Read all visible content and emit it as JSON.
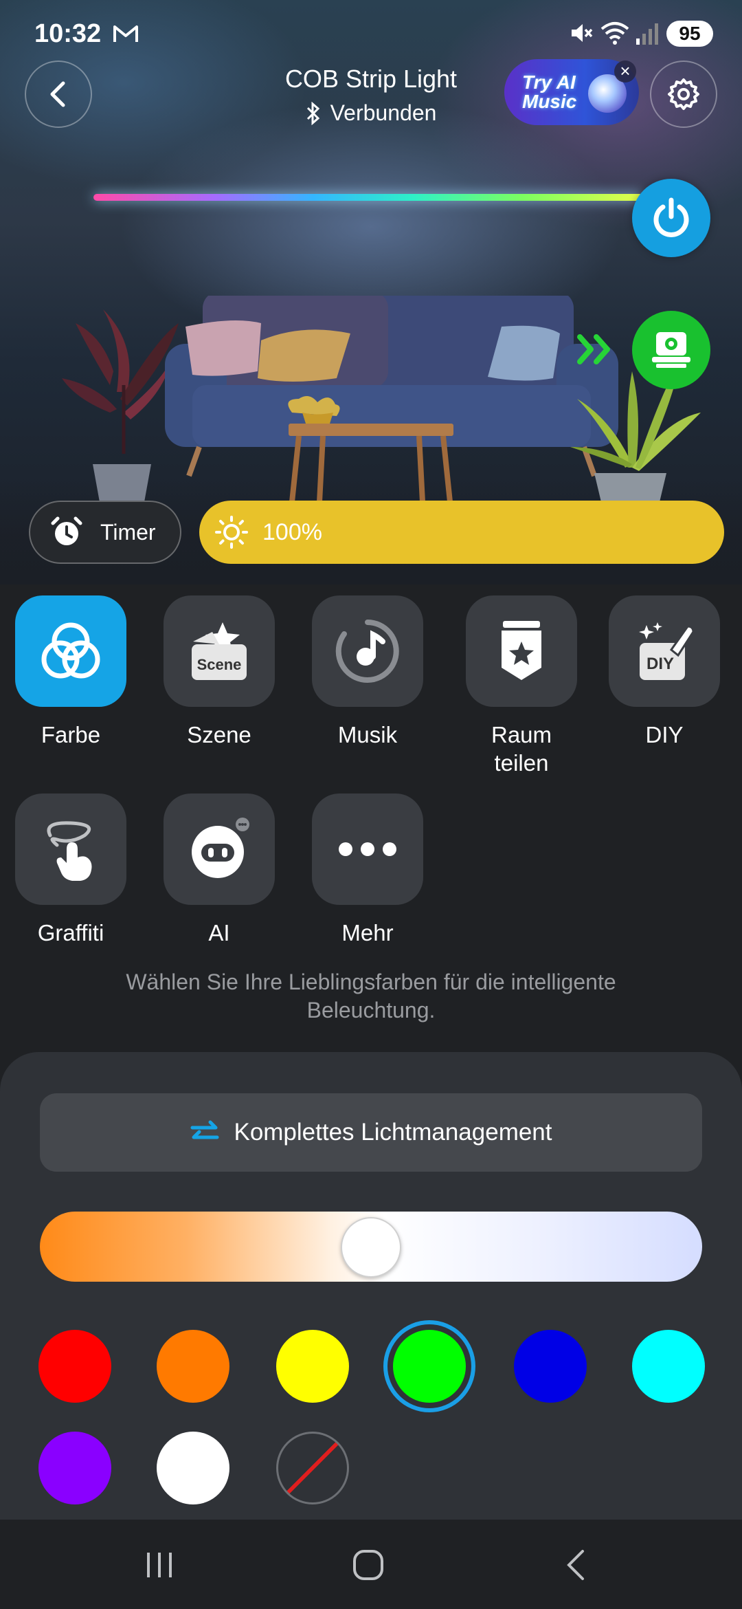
{
  "status_bar": {
    "time": "10:32",
    "battery": "95"
  },
  "header": {
    "title": "COB Strip Light",
    "connection_status": "Verbunden",
    "ai_banner_text": "Try AI Music"
  },
  "controls": {
    "timer_label": "Timer",
    "brightness_value": "100%",
    "brightness_level": 1.0
  },
  "modes": [
    {
      "label": "Farbe",
      "icon": "color-circles-icon",
      "active": true
    },
    {
      "label": "Szene",
      "icon": "scene-icon",
      "active": false,
      "badge": "Scene"
    },
    {
      "label": "Musik",
      "icon": "music-icon",
      "active": false
    },
    {
      "label": "Raum\nteilen",
      "icon": "share-room-icon",
      "active": false
    },
    {
      "label": "DIY",
      "icon": "diy-icon",
      "active": false,
      "badge": "DIY"
    },
    {
      "label": "Graffiti",
      "icon": "graffiti-icon",
      "active": false
    },
    {
      "label": "AI",
      "icon": "ai-robot-icon",
      "active": false
    },
    {
      "label": "Mehr",
      "icon": "more-icon",
      "active": false
    }
  ],
  "hint_text": "Wählen Sie Ihre Lieblingsfarben für die intelligente Beleuchtung.",
  "sheet": {
    "manage_label": "Komplettes Lichtmanagement",
    "color_temperature_position": 0.5,
    "swatches": [
      "#ff0000",
      "#ff7a00",
      "#ffff00",
      "#00ff00",
      "#0000e6",
      "#00ffff",
      "#8a00ff",
      "#ffffff",
      "none"
    ],
    "selected_swatch": 3
  },
  "colors": {
    "accent": "#15a4e6",
    "power": "#159fe0",
    "device": "#19c12f",
    "brightness": "#e8c22a"
  }
}
